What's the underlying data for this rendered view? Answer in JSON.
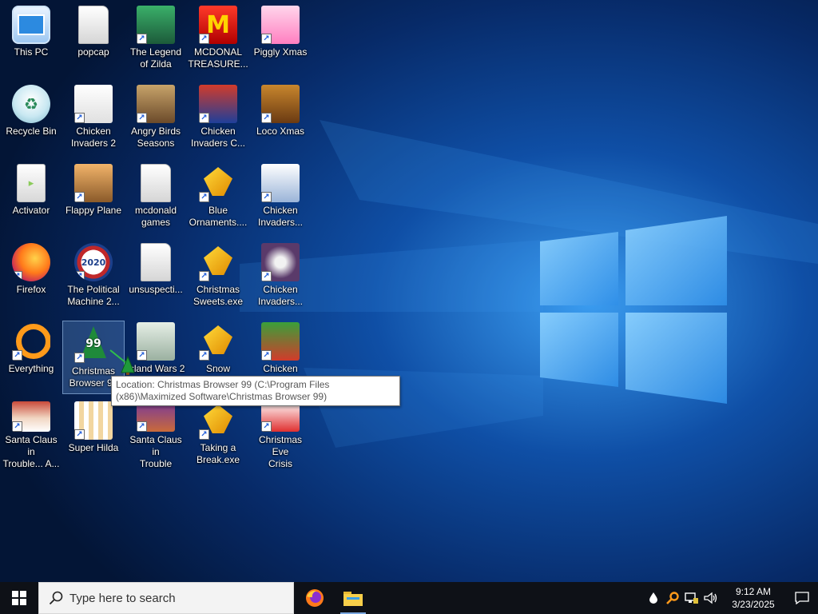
{
  "desktop": {
    "icons": [
      {
        "label": "This PC",
        "icon": "computer-icon"
      },
      {
        "label": "popcap",
        "icon": "folder-icon"
      },
      {
        "label": "The Legend\nof Zilda",
        "icon": "game-icon"
      },
      {
        "label": "MCDONAL\nTREASURE...",
        "icon": "game-icon"
      },
      {
        "label": "Piggly Xmas",
        "icon": "game-icon"
      },
      {
        "label": "Recycle Bin",
        "icon": "recycle-bin-icon"
      },
      {
        "label": "Chicken\nInvaders 2",
        "icon": "game-icon"
      },
      {
        "label": "Angry Birds\nSeasons",
        "icon": "game-icon"
      },
      {
        "label": "Chicken\nInvaders C...",
        "icon": "game-icon"
      },
      {
        "label": "Loco Xmas",
        "icon": "game-icon"
      },
      {
        "label": "Activator",
        "icon": "file-icon"
      },
      {
        "label": "Flappy Plane",
        "icon": "game-icon"
      },
      {
        "label": "mcdonald\ngames",
        "icon": "folder-icon"
      },
      {
        "label": "Blue\nOrnaments....",
        "icon": "game-icon"
      },
      {
        "label": "Chicken\nInvaders...",
        "icon": "game-icon"
      },
      {
        "label": "Firefox",
        "icon": "firefox-icon"
      },
      {
        "label": "The Political\nMachine 2...",
        "icon": "game-icon"
      },
      {
        "label": "unsuspecti...",
        "icon": "folder-icon"
      },
      {
        "label": "Christmas\nSweets.exe",
        "icon": "game-icon"
      },
      {
        "label": "Chicken\nInvaders...",
        "icon": "game-icon"
      },
      {
        "label": "Everything",
        "icon": "search-app-icon"
      },
      {
        "label": "Christmas\nBrowser 99",
        "icon": "christmas-tree-icon",
        "badge": "99"
      },
      {
        "label": "Island Wars 2",
        "icon": "game-icon"
      },
      {
        "label": "Snow",
        "icon": "game-icon"
      },
      {
        "label": "Chicken",
        "icon": "game-icon"
      },
      {
        "label": "Santa Claus in\nTrouble... A...",
        "icon": "game-icon"
      },
      {
        "label": "Super Hilda",
        "icon": "game-icon"
      },
      {
        "label": "Santa Claus in\nTrouble",
        "icon": "game-icon"
      },
      {
        "label": "Taking a\nBreak.exe",
        "icon": "game-icon"
      },
      {
        "label": "Christmas Eve\nCrisis",
        "icon": "game-icon"
      }
    ],
    "mcdonald_glyph": "M",
    "political_glyph": "2020",
    "recycle_glyph": "♻",
    "tooltip": "Location: Christmas Browser 99 (C:\\Program Files (x86)\\Maximized Software\\Christmas Browser 99)"
  },
  "taskbar": {
    "search_placeholder": "Type here to search",
    "pinned_apps": [
      "firefox-icon",
      "file-explorer-icon"
    ],
    "tray_icons": [
      "droplet-icon",
      "search-tray-icon",
      "network-icon",
      "volume-icon"
    ],
    "clock_time": "9:12 AM",
    "clock_date": "3/23/2025"
  },
  "colors": {
    "wallpaper_dark": "#041a44",
    "wallpaper_light": "#2f8fe8",
    "taskbar": "#0e1117",
    "accent": "#1e5bd8"
  }
}
